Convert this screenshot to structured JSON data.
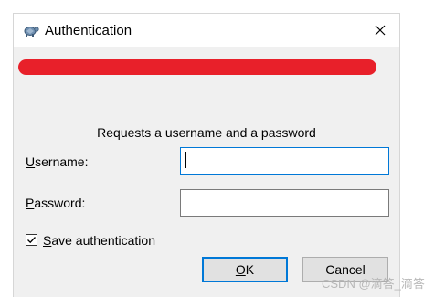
{
  "window": {
    "title": "Authentication"
  },
  "prompt": "Requests a username and a password",
  "username": {
    "label_accel": "U",
    "label_rest": "sername:",
    "value": ""
  },
  "password": {
    "label_accel": "P",
    "label_rest": "assword:",
    "value": ""
  },
  "save_auth": {
    "label_accel": "S",
    "label_rest": "ave authentication",
    "checked": true
  },
  "buttons": {
    "ok_accel": "O",
    "ok_rest": "K",
    "cancel_label": "Cancel"
  },
  "watermark": "CSDN @滴答_滴答",
  "icons": {
    "app": "turtle-icon",
    "close": "close-icon",
    "check": "check-icon"
  },
  "colors": {
    "redaction": "#e8202a",
    "focus_border": "#0078d7",
    "dialog_bg": "#f0f0f0"
  }
}
